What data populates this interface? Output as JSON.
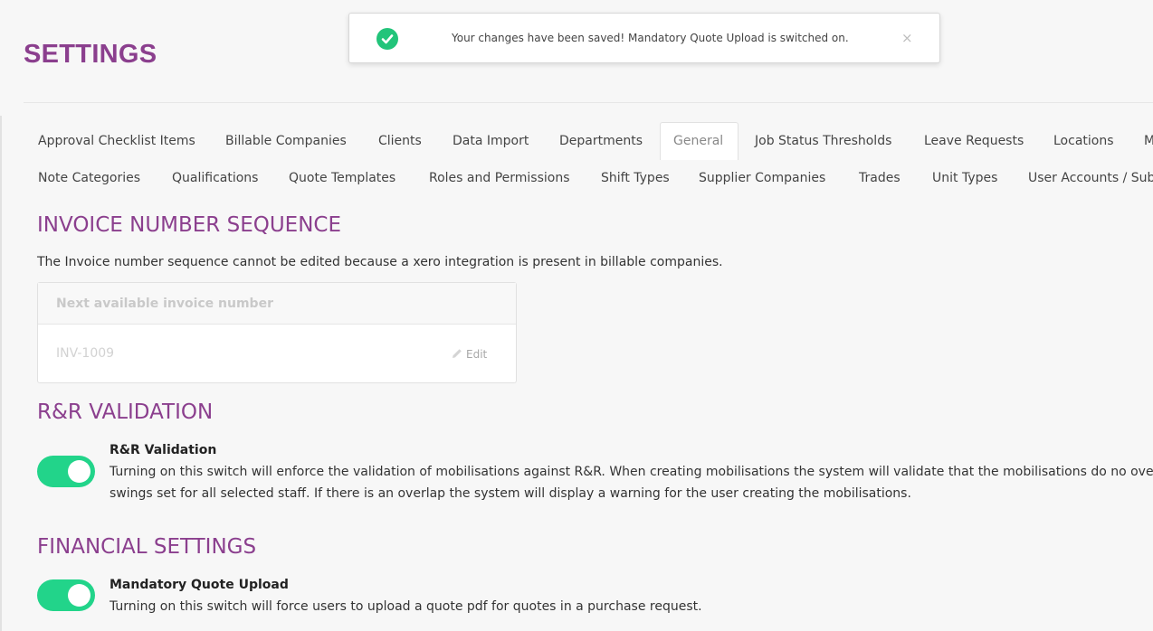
{
  "page": {
    "title": "SETTINGS"
  },
  "toast": {
    "message": "Your changes have been saved! Mandatory Quote Upload is switched on.",
    "close_symbol": "×",
    "icon": "check-circle-icon",
    "accent": "#22c47a"
  },
  "tabs": {
    "row1": [
      "Approval Checklist Items",
      "Billable Companies",
      "Clients",
      "Data Import",
      "Departments",
      "General",
      "Job Status Thresholds",
      "Leave Requests",
      "Locations",
      "M"
    ],
    "row2": [
      "Note Categories",
      "Qualifications",
      "Quote Templates",
      "Roles and Permissions",
      "Shift Types",
      "Supplier Companies",
      "Trades",
      "Unit Types",
      "User Accounts / Sub"
    ],
    "active": "General"
  },
  "invoice": {
    "title": "INVOICE NUMBER SEQUENCE",
    "note": "The Invoice number sequence cannot be edited because a xero integration is present in billable companies.",
    "field_label": "Next available invoice number",
    "value": "INV-1009",
    "edit_label": "Edit"
  },
  "rr": {
    "title": "R&R VALIDATION",
    "setting_name": "R&R Validation",
    "desc_line1": "Turning on this switch will enforce the validation of mobilisations against R&R. When creating mobilisations the system will validate that the mobilisations do no overla",
    "desc_line2": "swings set for all selected staff. If there is an overlap the system will display a warning for the user creating the mobilisations.",
    "enabled": true
  },
  "financial": {
    "title": "FINANCIAL SETTINGS",
    "setting_name": "Mandatory Quote Upload",
    "desc": "Turning on this switch will force users to upload a quote pdf for quotes in a purchase request.",
    "enabled": true
  },
  "colors": {
    "brand": "#8b3f8e",
    "toggle_on": "#22d48a"
  }
}
